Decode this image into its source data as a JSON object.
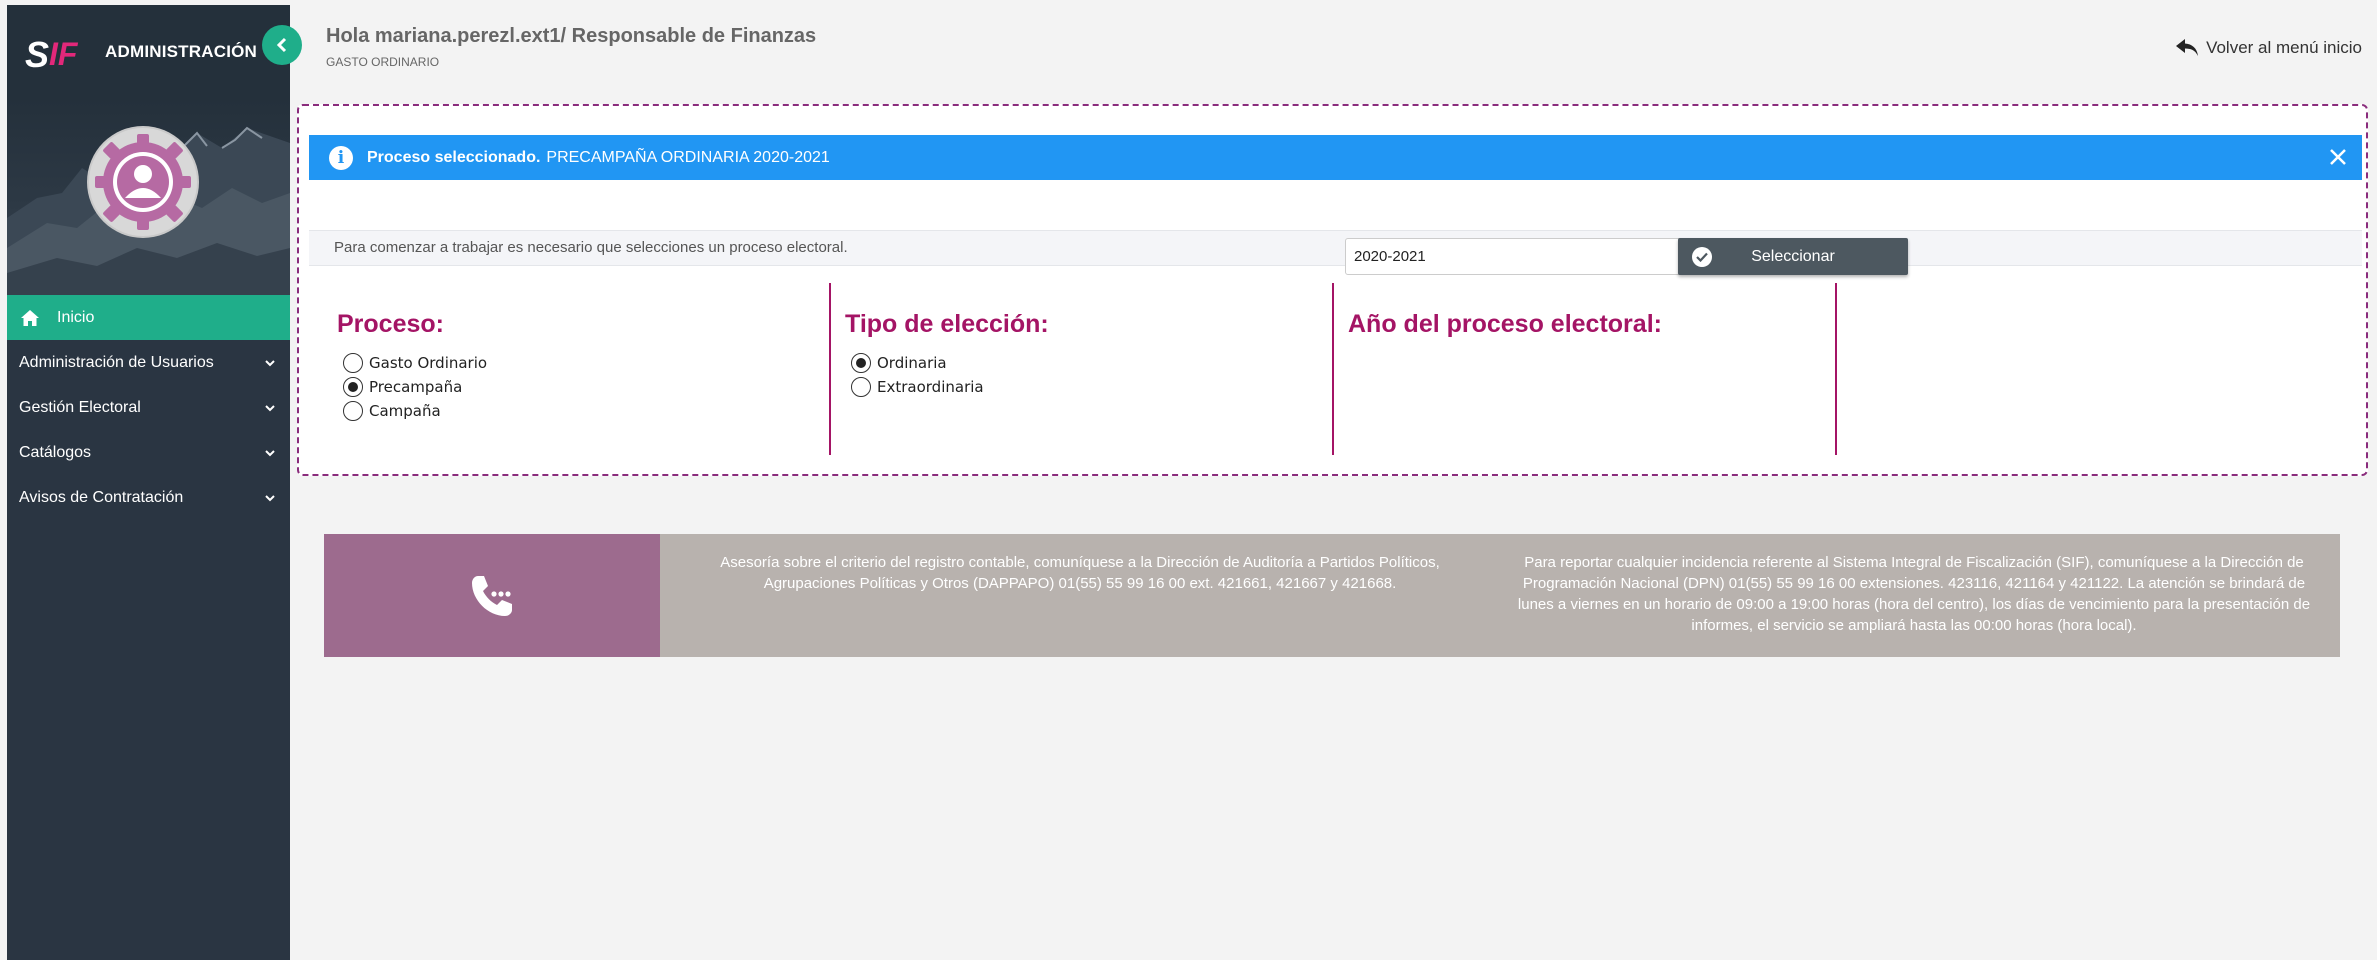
{
  "sidebar": {
    "brand_title": "ADMINISTRACIÓN",
    "logo_s": "S",
    "logo_if": "IF",
    "items": [
      {
        "label": "Inicio",
        "active": true
      },
      {
        "label": "Administración de Usuarios"
      },
      {
        "label": "Gestión Electoral"
      },
      {
        "label": "Catálogos"
      },
      {
        "label": "Avisos de Contratación"
      }
    ]
  },
  "header": {
    "greeting": "Hola mariana.perezl.ext1/ Responsable de Finanzas",
    "subtitle": "GASTO ORDINARIO",
    "back_label": "Volver al menú inicio"
  },
  "alert": {
    "bold_text": "Proceso seleccionado.",
    "text": "PRECAMPAÑA ORDINARIA 2020-2021"
  },
  "instructions": "Para comenzar a trabajar es necesario que selecciones un proceso electoral.",
  "form": {
    "proceso": {
      "title": "Proceso:",
      "options": [
        "Gasto Ordinario",
        "Precampaña",
        "Campaña"
      ],
      "selected": "Precampaña"
    },
    "tipo": {
      "title": "Tipo de elección:",
      "options": [
        "Ordinaria",
        "Extraordinaria"
      ],
      "selected": "Ordinaria"
    },
    "anio": {
      "title": "Año del proceso electoral:",
      "value": "2020-2021"
    },
    "select_button": "Seleccionar"
  },
  "footer": {
    "text1": "Asesoría sobre el criterio del registro contable, comuníquese a la Dirección de Auditoría a Partidos Políticos, Agrupaciones Políticas y Otros (DAPPAPO) 01(55) 55 99 16 00 ext. 421661, 421667 y 421668.",
    "text2": "Para reportar cualquier incidencia referente al Sistema Integral de Fiscalización (SIF), comuníquese a la Dirección de Programación Nacional (DPN) 01(55) 55 99 16 00 extensiones. 423116, 421164 y 421122. La atención se brindará de lunes a viernes en un horario de 09:00 a 19:00 horas (hora del centro), los días de vencimiento para la presentación de informes, el servicio se ampliará hasta las 00:00 horas (hora local)."
  },
  "colors": {
    "sidebar": "#2a3542",
    "accent_green": "#1fae8a",
    "alert_blue": "#2196f3",
    "brand_magenta": "#a41465",
    "footer_purple": "#9d6b8e"
  }
}
